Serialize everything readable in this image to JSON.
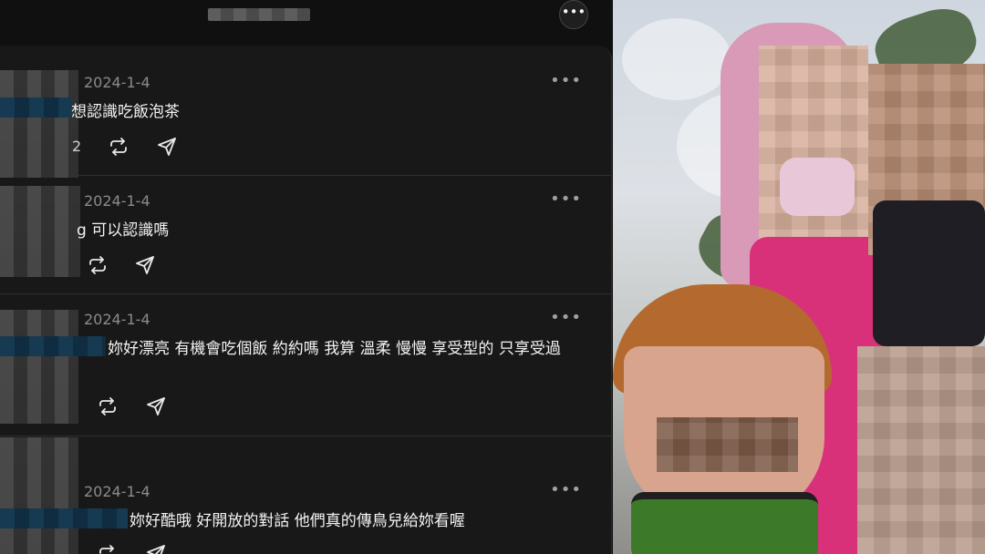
{
  "header": {
    "more_glyph": "•••"
  },
  "posts": [
    {
      "date": "2024-1-4",
      "text": "想認識吃飯泡茶",
      "more": "•••",
      "count": "2"
    },
    {
      "date": "2024-1-4",
      "text": "g 可以認識嗎",
      "more": "•••"
    },
    {
      "date": "2024-1-4",
      "text": "妳好漂亮 有機會吃個飯 約約嗎 我算 溫柔 慢慢 享受型的 只享受過",
      "more": "•••"
    },
    {
      "date": "2024-1-4",
      "text": "妳好酷哦 好開放的對話 他們真的傳鳥兒給妳看喔",
      "more": "•••"
    }
  ],
  "icons": {
    "repost": "repost-icon",
    "share": "share-icon",
    "more": "more-icon"
  }
}
